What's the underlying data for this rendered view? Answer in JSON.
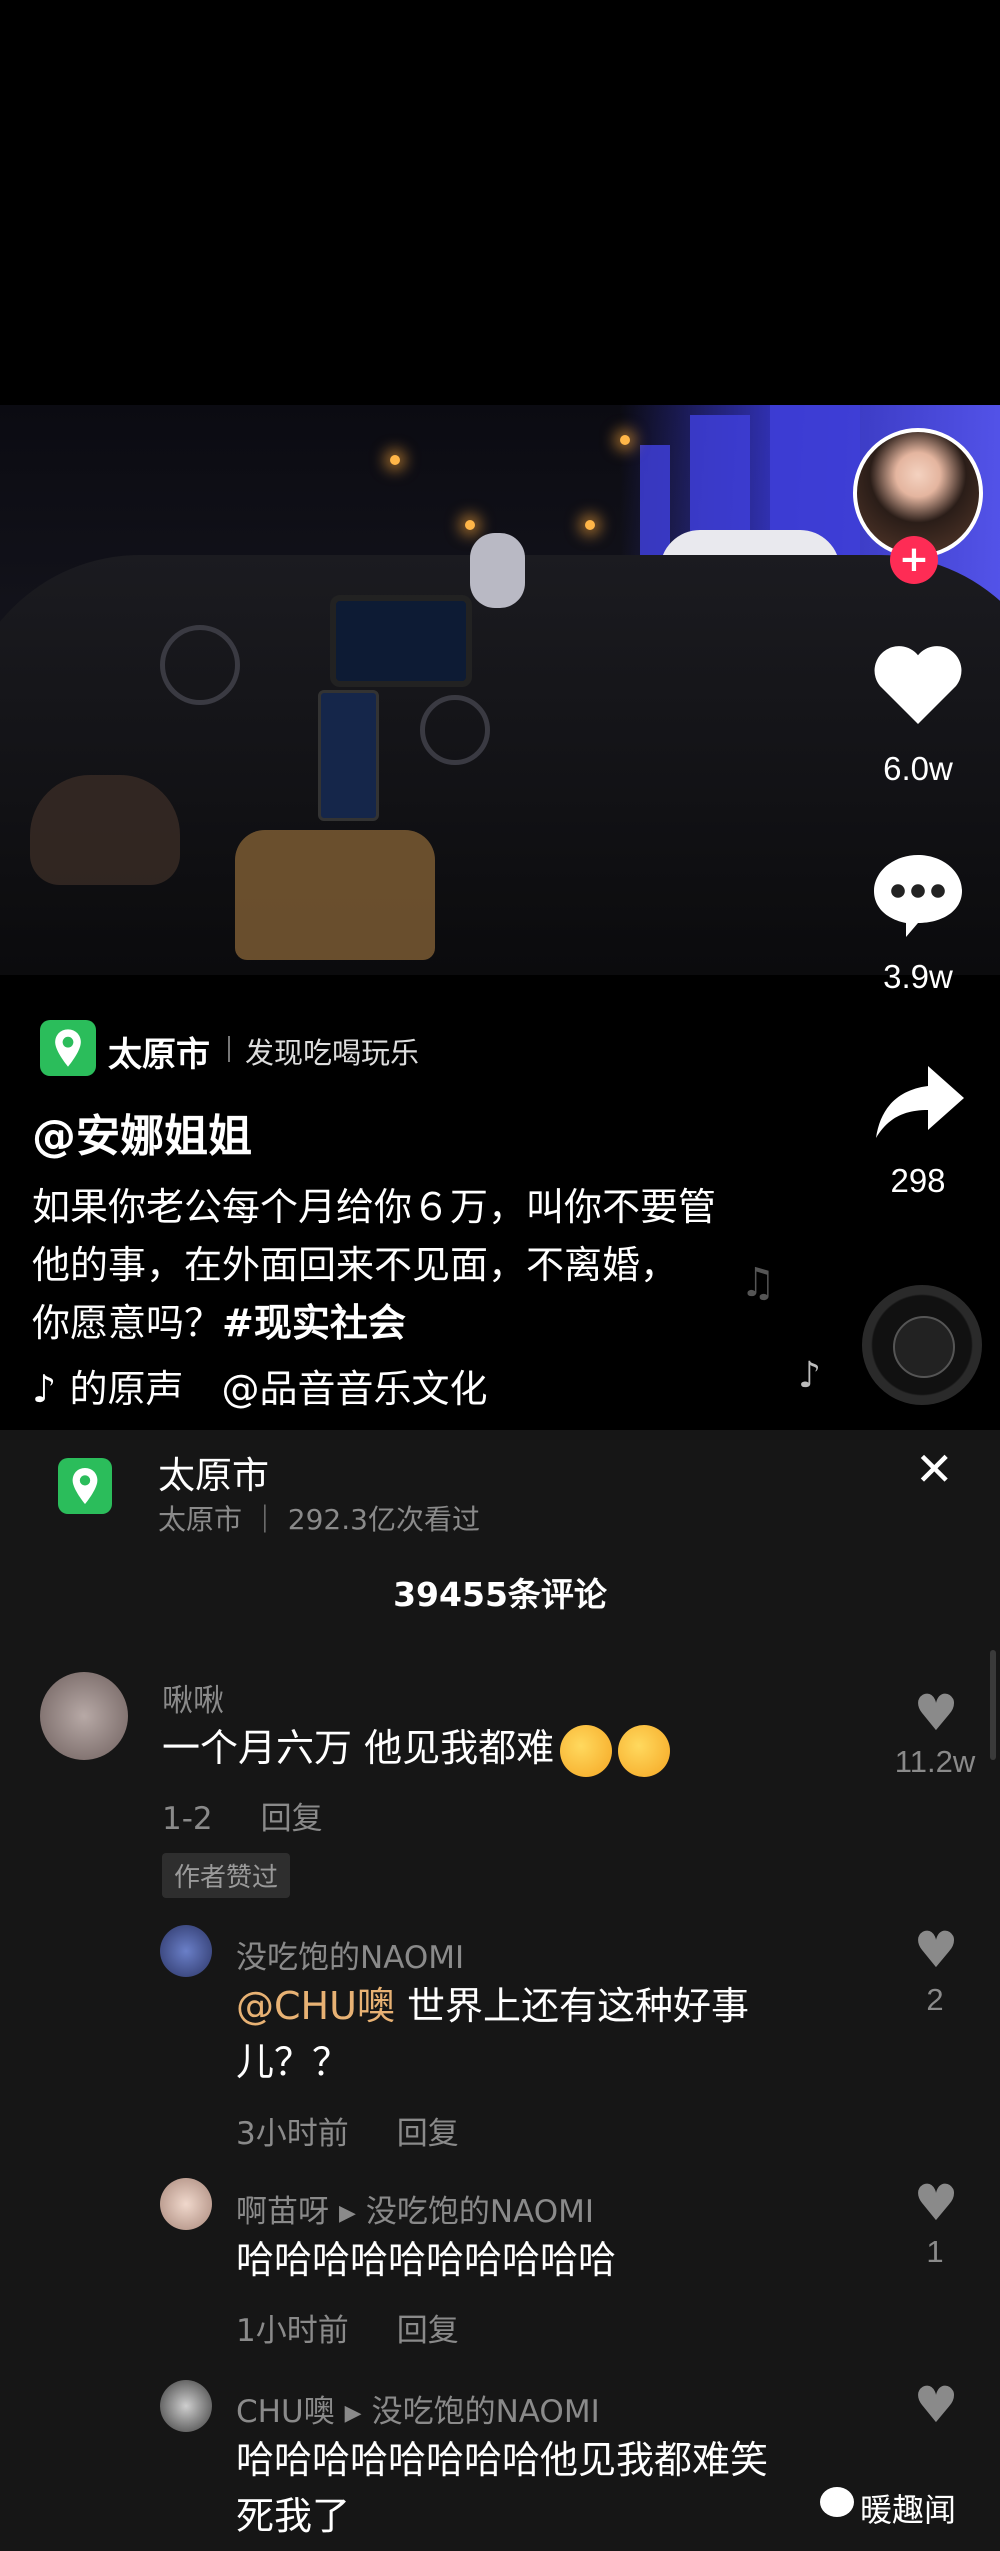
{
  "video": {
    "likes": "6.0w",
    "comments": "3.9w",
    "shares": "298",
    "location_name": "太原市",
    "location_sub": "发现吃喝玩乐",
    "author": "@安娜姐姐",
    "caption_line1": "如果你老公每个月给你６万，叫你不要管",
    "caption_line2": "他的事，在外面回来不见面，不离婚，",
    "caption_line3": "你愿意吗？",
    "hashtag": "#现实社会",
    "music": "的原声　@品音音乐文化",
    "plus": "+"
  },
  "panel": {
    "title": "太原市",
    "subtitle": "太原市 ｜ 292.3亿次看过",
    "close": "✕",
    "comment_count": "39455条评论"
  },
  "comments": [
    {
      "name": "啾啾",
      "text": "一个月六万 他见我都难",
      "meta_count": "1-2",
      "reply": "回复",
      "likes": "11.2w",
      "badge": "作者赞过"
    },
    {
      "name": "没吃饱的NAOMI",
      "mention": "@CHU噢",
      "text_a": " 世界上还有这种好事",
      "text_b": "儿？？",
      "time": "3小时前",
      "reply": "回复",
      "likes": "2"
    },
    {
      "name": "啊苗呀",
      "reply_to": "没吃饱的NAOMI",
      "text": "哈哈哈哈哈哈哈哈哈哈",
      "time": "1小时前",
      "reply": "回复",
      "likes": "1"
    },
    {
      "name": "CHU噢",
      "reply_to": "没吃饱的NAOMI",
      "text_a": "哈哈哈哈哈哈哈哈他见我都难笑",
      "text_b": "死我了"
    }
  ],
  "watermark": "暖趣闻",
  "colors": {
    "accent_red": "#fe2c55",
    "location_green": "#2bbd5b",
    "mention": "#e8b274",
    "panel_bg": "#161616"
  }
}
